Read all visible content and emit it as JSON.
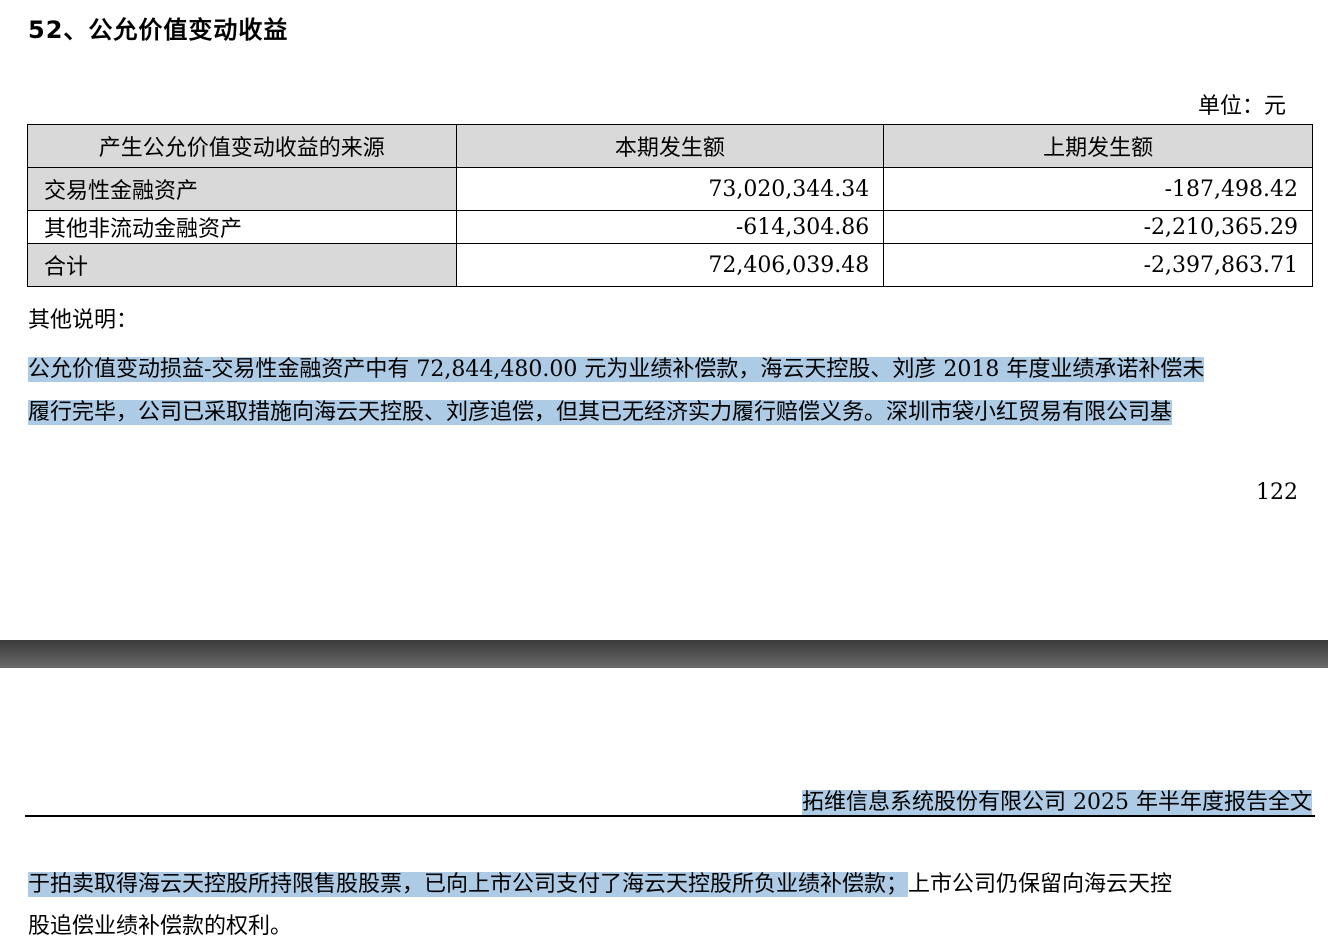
{
  "section": {
    "title": "52、公允价值变动收益"
  },
  "unit_label": "单位：元",
  "table": {
    "headers": [
      "产生公允价值变动收益的来源",
      "本期发生额",
      "上期发生额"
    ],
    "rows": [
      {
        "source": "交易性金融资产",
        "current": "73,020,344.34",
        "previous": "-187,498.42"
      },
      {
        "source": "其他非流动金融资产",
        "current": "-614,304.86",
        "previous": "-2,210,365.29"
      },
      {
        "source": "合计",
        "current": "72,406,039.48",
        "previous": "-2,397,863.71"
      }
    ]
  },
  "other_notes_label": "其他说明：",
  "paragraph1": {
    "line1": "公允价值变动损益-交易性金融资产中有 72,844,480.00 元为业绩补偿款，海云天控股、刘彦 2018 年度业绩承诺补偿未",
    "line2": "履行完毕，公司已采取措施向海云天控股、刘彦追偿，但其已无经济实力履行赔偿义务。深圳市袋小红贸易有限公司基"
  },
  "page_number": "122",
  "report_header": "拓维信息系统股份有限公司 2025 年半年度报告全文",
  "paragraph2": {
    "line1_highlighted": "于拍卖取得海云天控股所持限售股股票，已向上市公司支付了海云天控股所负业绩补偿款；",
    "line1_rest": "上市公司仍保留向海云天控",
    "line2": "股追偿业绩补偿款的权利。"
  },
  "colors": {
    "highlight": "#aecbe5",
    "table_header_bg": "#d9d9d9",
    "divider": "#555555"
  }
}
